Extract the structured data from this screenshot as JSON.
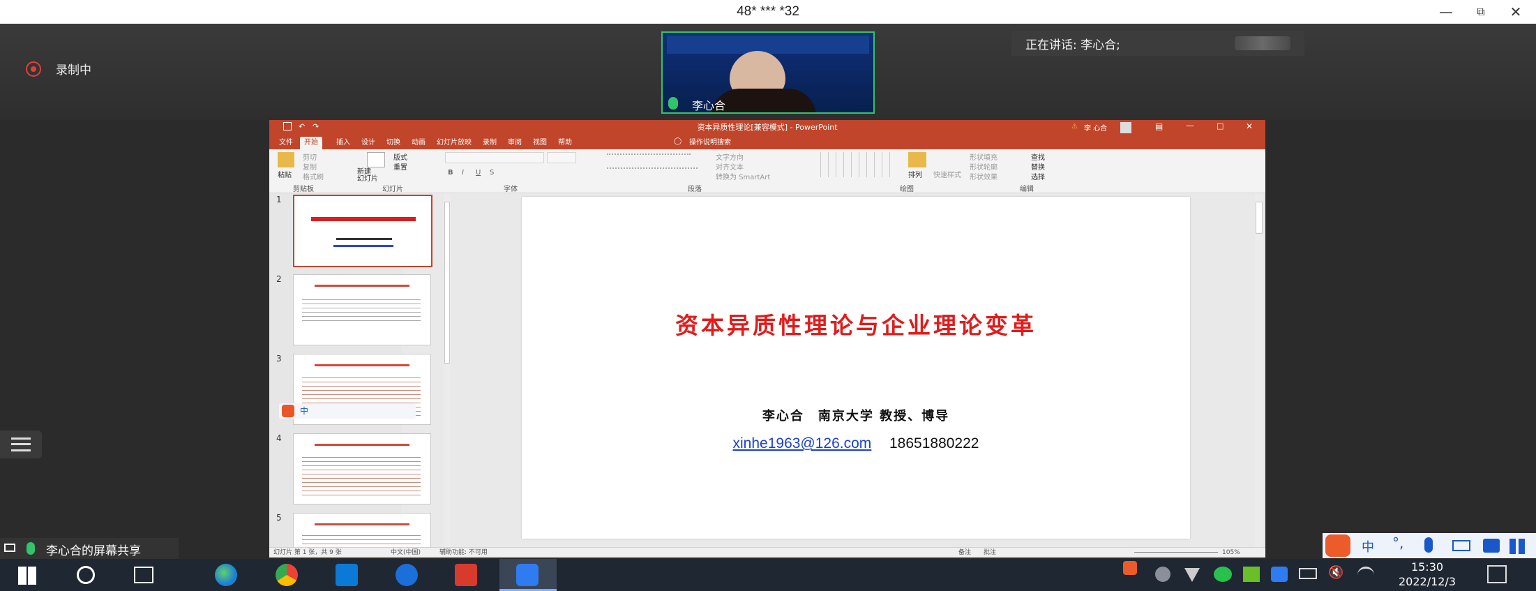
{
  "window": {
    "title": "48* *** *32"
  },
  "meeting": {
    "recording_label": "录制中",
    "video_name": "李心合",
    "speaking_label": "正在讲话: 李心合;",
    "share_label": "李心合的屏幕共享"
  },
  "ppt": {
    "title": "资本异质性理论[兼容模式] - PowerPoint",
    "user": "李 心合",
    "tabs": [
      "文件",
      "开始",
      "插入",
      "设计",
      "切换",
      "动画",
      "幻灯片放映",
      "录制",
      "审阅",
      "视图",
      "帮助"
    ],
    "search": "操作说明搜索",
    "groups": {
      "clipboard": "剪贴板",
      "paste": "粘贴",
      "cut": "剪切",
      "copy": "复制",
      "format_painter": "格式刷",
      "slides": "幻灯片",
      "new_slide": "新建\n幻灯片",
      "layout": "版式",
      "reset": "重置",
      "font": "字体",
      "paragraph": "段落",
      "text_direction": "文字方向",
      "align_text": "对齐文本",
      "smartart": "转换为 SmartArt",
      "drawing": "绘图",
      "arrange": "排列",
      "quick_styles": "快速样式",
      "shape_fill": "形状填充",
      "shape_outline": "形状轮廓",
      "shape_effects": "形状效果",
      "editing": "编辑",
      "find": "查找",
      "replace": "替换",
      "select": "选择"
    },
    "thumb_numbers": [
      "1",
      "2",
      "3",
      "4",
      "5"
    ],
    "slide": {
      "title": "资本异质性理论与企业理论变革",
      "author": "李心合　南京大学 教授、博导",
      "email": "xinhe1963@126.com",
      "phone": "18651880222"
    },
    "status": {
      "slide_pos": "幻灯片 第 1 张，共 9 张",
      "language": "中文(中国)",
      "accessibility": "辅助功能: 不可用",
      "notes": "备注",
      "comments": "批注",
      "zoom": "105%"
    }
  },
  "taskbar": {
    "time": "15:30",
    "date": "2022/12/3",
    "ime_label": "中"
  },
  "colors": {
    "ppt_accent": "#c0452a",
    "slide_title": "#e21b1b",
    "video_border": "#31c46a",
    "taskbar": "#1f2733"
  }
}
